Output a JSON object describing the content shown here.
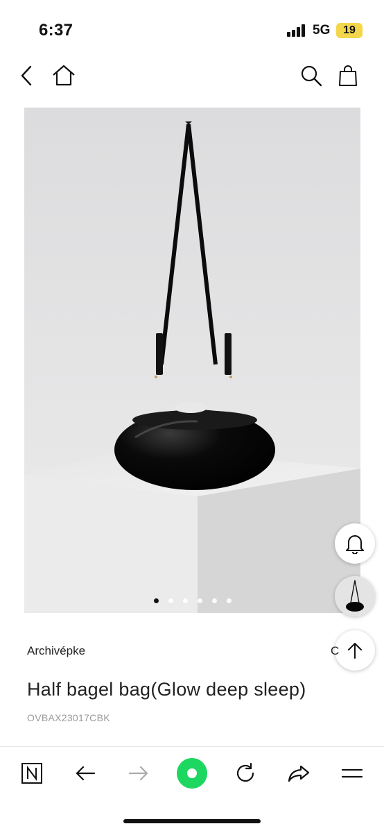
{
  "status_bar": {
    "time": "6:37",
    "network": "5G",
    "battery": "19"
  },
  "header": {
    "icons": [
      "back-chevron-icon",
      "home-icon",
      "search-icon",
      "shopping-bag-icon"
    ]
  },
  "product": {
    "brand": "Archivépke",
    "name": "Half bagel bag(Glow deep sleep)",
    "code": "OVBAX23017CBK",
    "image_description_icon": "black-glossy-handbag-image",
    "carousel": {
      "total": 6,
      "active_index": 0
    }
  },
  "floating": {
    "icons": [
      "bell-icon",
      "thumbnail-image",
      "arrow-up-icon"
    ]
  },
  "right_peek_text": "C",
  "toolbar": {
    "icons": [
      "n-logo-icon",
      "arrow-left-icon",
      "arrow-right-icon",
      "green-circle-icon",
      "reload-icon",
      "share-icon",
      "menu-icon"
    ],
    "accent_color": "#1ed760"
  }
}
